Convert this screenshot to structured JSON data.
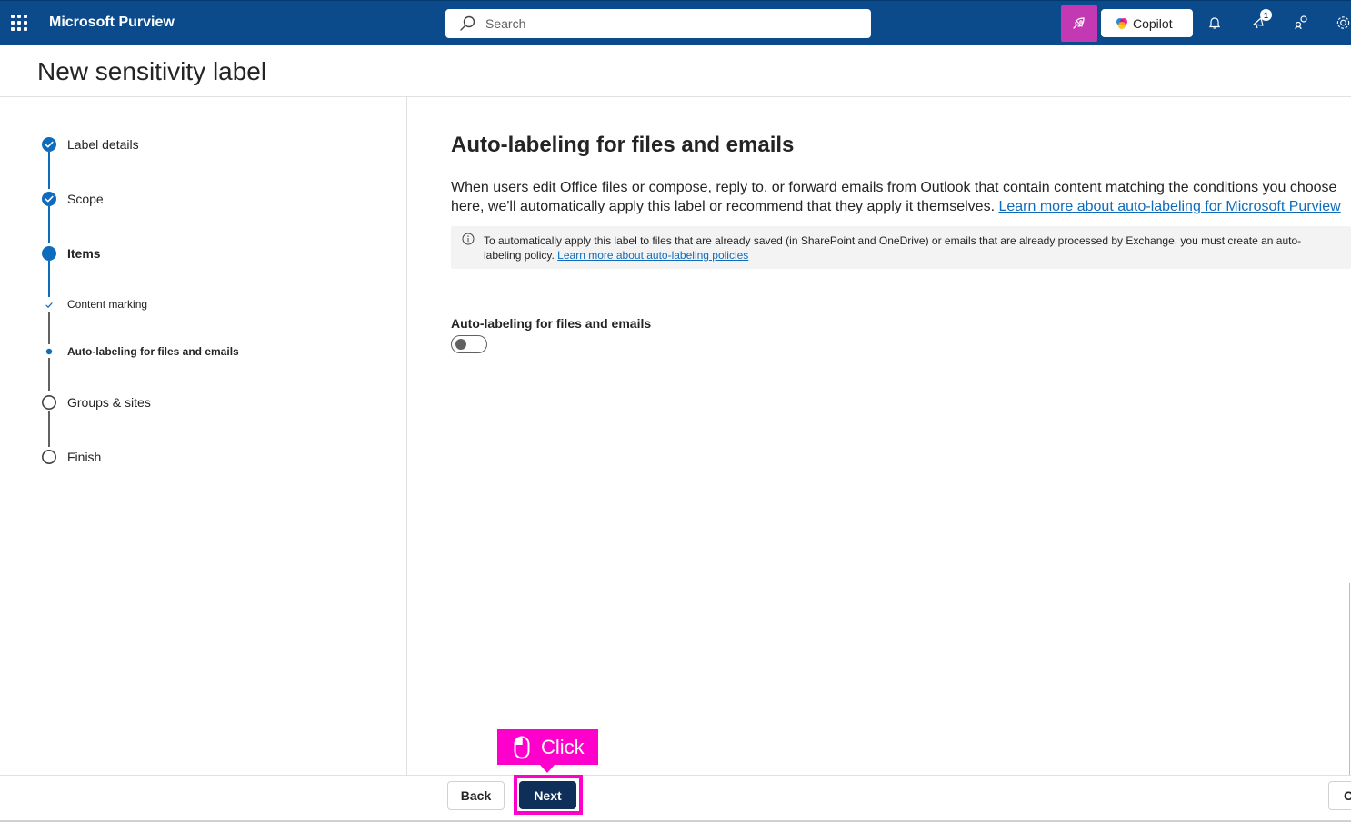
{
  "app": {
    "name": "Microsoft Purview"
  },
  "search": {
    "placeholder": "Search"
  },
  "topbar": {
    "copilot_label": "Copilot",
    "notification_count": "1"
  },
  "page": {
    "title": "New sensitivity label"
  },
  "steps": [
    {
      "label": "Label details",
      "state": "completed"
    },
    {
      "label": "Scope",
      "state": "completed"
    },
    {
      "label": "Items",
      "state": "current"
    },
    {
      "label": "Content marking",
      "state": "sub-completed"
    },
    {
      "label": "Auto-labeling for files and emails",
      "state": "sub-current"
    },
    {
      "label": "Groups & sites",
      "state": "pending"
    },
    {
      "label": "Finish",
      "state": "pending"
    }
  ],
  "main": {
    "title": "Auto-labeling for files and emails",
    "description": "When users edit Office files or compose, reply to, or forward emails from Outlook that contain content matching the conditions you choose here, we'll automatically apply this label or recommend that they apply it themselves.",
    "description_link": "Learn more about auto-labeling for Microsoft Purview",
    "info_text": "To automatically apply this label to files that are already saved (in SharePoint and OneDrive) or emails that are already processed by Exchange, you must create an auto-labeling policy.",
    "info_link": "Learn more about auto-labeling policies",
    "toggle_label": "Auto-labeling for files and emails",
    "toggle_on": false
  },
  "footer": {
    "back_label": "Back",
    "next_label": "Next",
    "cancel_label_partial": "C"
  },
  "overlay": {
    "click_label": "Click"
  },
  "colors": {
    "topbar": "#0b4b8c",
    "accent": "#0f6cbd",
    "highlight": "#ff00cc",
    "feedback": "#c239b3",
    "primary_button": "#0e2f5a"
  }
}
